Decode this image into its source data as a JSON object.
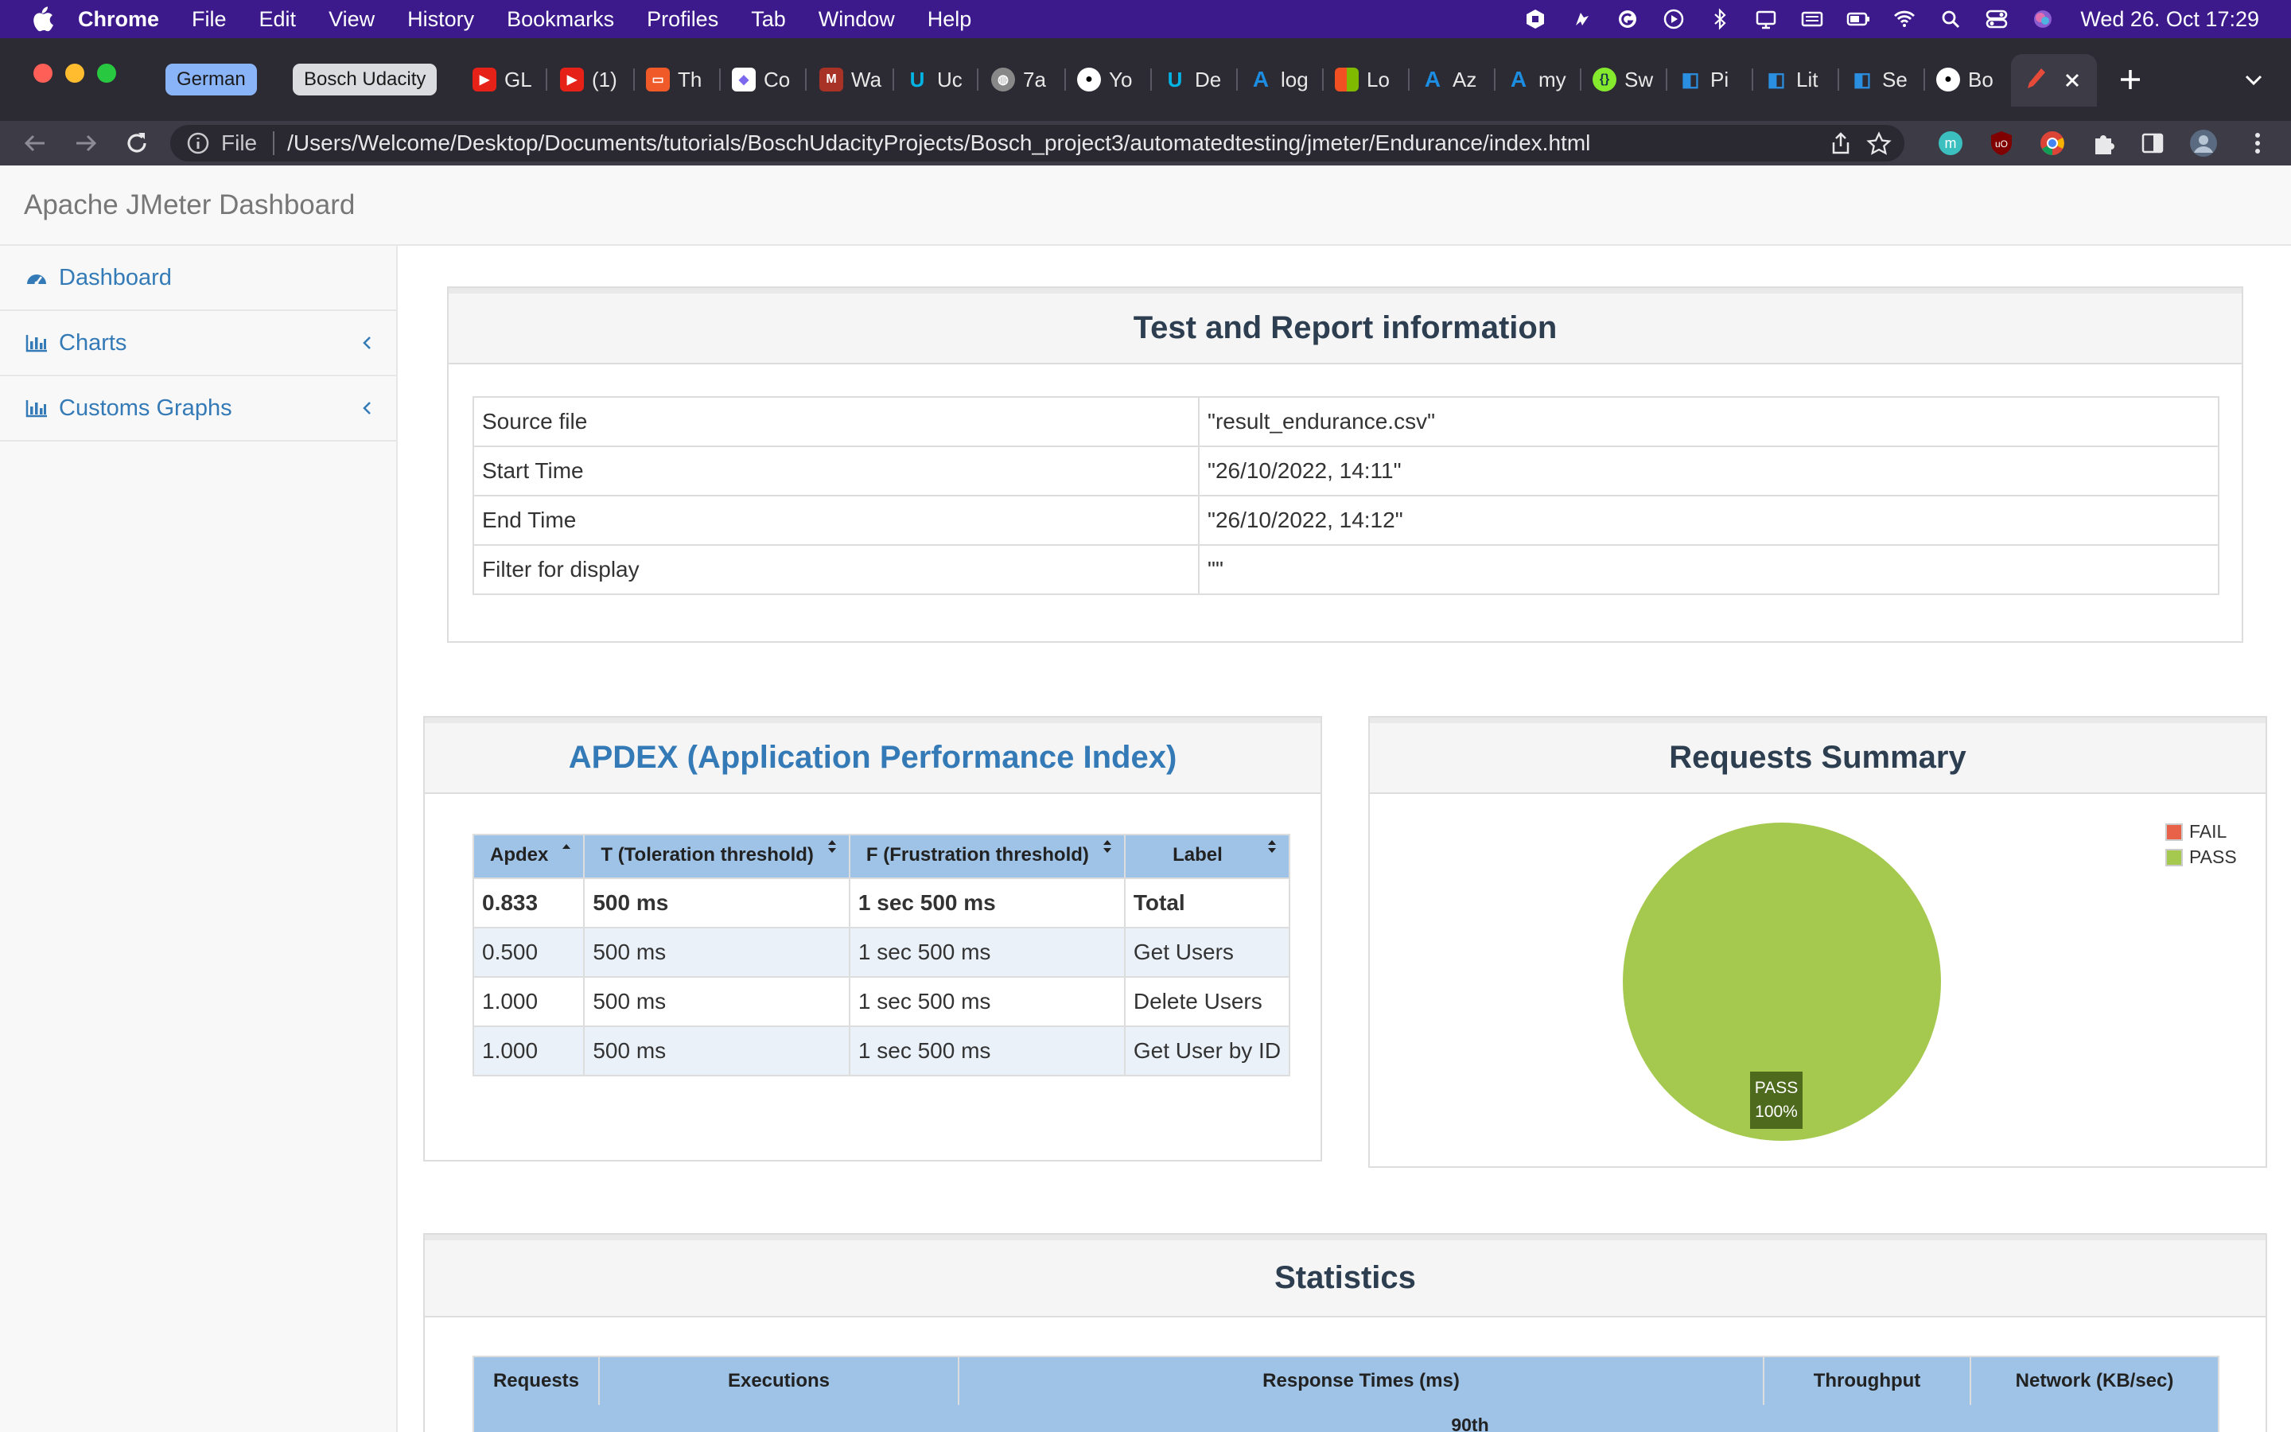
{
  "menubar": {
    "app": "Chrome",
    "items": [
      "File",
      "Edit",
      "View",
      "History",
      "Bookmarks",
      "Profiles",
      "Tab",
      "Window",
      "Help"
    ],
    "clock": "Wed 26. Oct  17:29",
    "status_icons": [
      "proxy-icon",
      "pointer-icon",
      "grammarly-icon",
      "play-icon",
      "bluetooth-icon",
      "display-icon",
      "keyboard-icon",
      "battery-icon",
      "wifi-icon",
      "spotlight-icon",
      "control-center-icon",
      "siri-icon"
    ]
  },
  "tabs": {
    "group_german": "German",
    "group_bosch": "Bosch Udacity",
    "items": [
      "GL",
      "(1)",
      "Th",
      "Co",
      "Wa",
      "Uc",
      "7a",
      "Yo",
      "De",
      "log",
      "Lo",
      "Az",
      "my",
      "Sw",
      "Pi",
      "Lit",
      "Se",
      "Bo"
    ]
  },
  "address": {
    "scheme_label": "File",
    "url": "/Users/Welcome/Desktop/Documents/tutorials/BoschUdacityProjects/Bosch_project3/automatedtesting/jmeter/Endurance/index.html"
  },
  "app": {
    "brand": "Apache JMeter Dashboard",
    "sidebar": [
      {
        "label": "Dashboard"
      },
      {
        "label": "Charts"
      },
      {
        "label": "Customs Graphs"
      }
    ]
  },
  "test_info": {
    "title": "Test and Report information",
    "rows": [
      {
        "key": "Source file",
        "value": "\"result_endurance.csv\""
      },
      {
        "key": "Start Time",
        "value": "\"26/10/2022, 14:11\""
      },
      {
        "key": "End Time",
        "value": "\"26/10/2022, 14:12\""
      },
      {
        "key": "Filter for display",
        "value": "\"\""
      }
    ]
  },
  "apdex": {
    "title": "APDEX (Application Performance Index)",
    "headers": [
      "Apdex",
      "T (Toleration threshold)",
      "F (Frustration threshold)",
      "Label"
    ],
    "rows": [
      [
        "0.833",
        "500 ms",
        "1 sec 500 ms",
        "Total"
      ],
      [
        "0.500",
        "500 ms",
        "1 sec 500 ms",
        "Get Users"
      ],
      [
        "1.000",
        "500 ms",
        "1 sec 500 ms",
        "Delete Users"
      ],
      [
        "1.000",
        "500 ms",
        "1 sec 500 ms",
        "Get User by ID"
      ]
    ]
  },
  "requests_summary": {
    "title": "Requests Summary",
    "legend_fail": "FAIL",
    "legend_pass": "PASS",
    "slice_label": "PASS",
    "slice_pct": "100%"
  },
  "chart_data": {
    "type": "pie",
    "title": "Requests Summary",
    "categories": [
      "FAIL",
      "PASS"
    ],
    "values": [
      0,
      100
    ],
    "colors": {
      "FAIL": "#e8624a",
      "PASS": "#a5c94f"
    },
    "legend_position": "top-right"
  },
  "statistics": {
    "title": "Statistics",
    "groups": [
      "Requests",
      "Executions",
      "Response Times (ms)",
      "Throughput",
      "Network (KB/sec)"
    ],
    "partial_header": "90th"
  },
  "colors": {
    "menubar": "#3c1a8c",
    "link": "#337ab7",
    "table_header": "#9ec3e6",
    "pass": "#a5c94f",
    "fail": "#e8624a"
  }
}
